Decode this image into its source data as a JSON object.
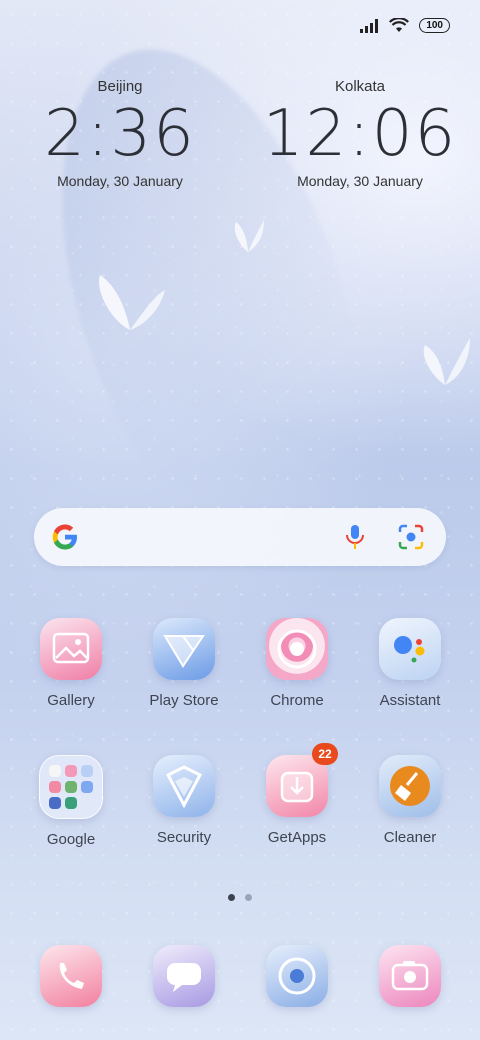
{
  "status_bar": {
    "signal_icon": "signal-bars-icon",
    "wifi_icon": "wifi-icon",
    "battery_level": "100"
  },
  "clocks": [
    {
      "city": "Beijing",
      "time": "2:36",
      "date": "Monday, 30 January"
    },
    {
      "city": "Kolkata",
      "time": "12:06",
      "date": "Monday, 30 January"
    }
  ],
  "search": {
    "logo_icon": "google-g-icon",
    "mic_icon": "microphone-icon",
    "lens_icon": "camera-lens-icon"
  },
  "apps": {
    "row1": [
      {
        "label": "Gallery",
        "icon": "gallery-icon"
      },
      {
        "label": "Play Store",
        "icon": "play-store-icon"
      },
      {
        "label": "Chrome",
        "icon": "chrome-icon"
      },
      {
        "label": "Assistant",
        "icon": "assistant-icon"
      }
    ],
    "row2": [
      {
        "label": "Google",
        "icon": "folder-icon"
      },
      {
        "label": "Security",
        "icon": "security-shield-icon"
      },
      {
        "label": "GetApps",
        "icon": "getapps-icon",
        "badge": "22"
      },
      {
        "label": "Cleaner",
        "icon": "broom-icon"
      }
    ]
  },
  "page_indicator": {
    "pages": 2,
    "active": 1
  },
  "dock": [
    {
      "icon": "phone-icon"
    },
    {
      "icon": "messages-icon"
    },
    {
      "icon": "browser-icon"
    },
    {
      "icon": "camera-icon"
    }
  ],
  "colors": {
    "badge": "#e8491d",
    "accent_pink": "#f07fa6",
    "accent_blue": "#6c9be6"
  }
}
